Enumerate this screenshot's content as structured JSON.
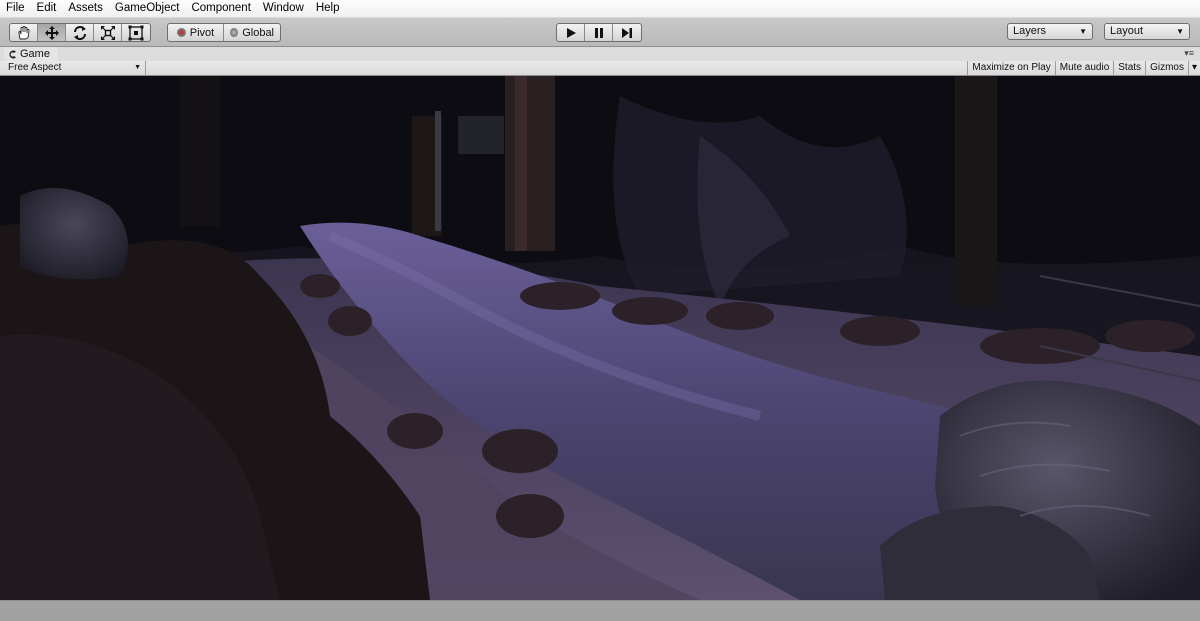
{
  "menu": [
    "File",
    "Edit",
    "Assets",
    "GameObject",
    "Component",
    "Window",
    "Help"
  ],
  "toolbar": {
    "tools": [
      {
        "name": "hand-tool",
        "icon": "hand-icon"
      },
      {
        "name": "move-tool",
        "icon": "move-arrows-icon"
      },
      {
        "name": "rotate-tool",
        "icon": "rotate-icon"
      },
      {
        "name": "scale-tool",
        "icon": "scale-icon"
      },
      {
        "name": "rect-tool",
        "icon": "rect-icon"
      }
    ],
    "active_tool": "move-tool",
    "pivot_label": "Pivot",
    "global_label": "Global",
    "play_icon": "play-icon",
    "pause_icon": "pause-icon",
    "step_icon": "step-icon",
    "layers_label": "Layers",
    "layout_label": "Layout"
  },
  "game_tab": {
    "label": "Game",
    "aspect_label": "Free Aspect",
    "buttons": [
      "Maximize on Play",
      "Mute audio",
      "Stats",
      "Gizmos"
    ]
  },
  "colors": {
    "toolbar_bg": "#bebebe",
    "path_tint": "#5a4f86",
    "forest_dark": "#0c0b12"
  }
}
